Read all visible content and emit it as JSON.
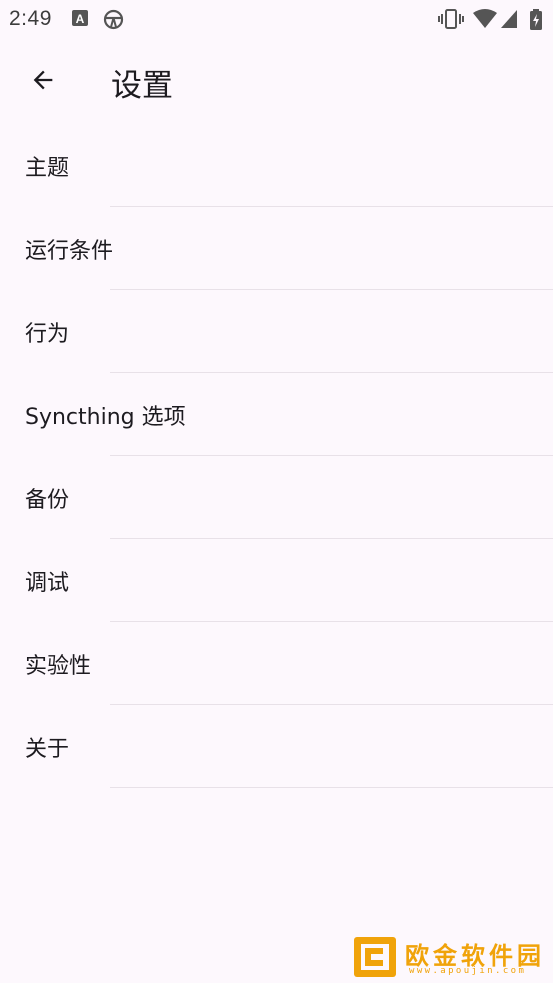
{
  "status_bar": {
    "time": "2:49",
    "icons": [
      "a-notification-icon",
      "steering-wheel-icon",
      "vibrate-icon",
      "wifi-icon",
      "cell-signal-icon",
      "battery-charging-icon"
    ]
  },
  "app_bar": {
    "back_icon": "arrow-back-icon",
    "title": "设置"
  },
  "settings": {
    "items": [
      {
        "label": "主题"
      },
      {
        "label": "运行条件"
      },
      {
        "label": "行为"
      },
      {
        "label": "Syncthing 选项"
      },
      {
        "label": "备份"
      },
      {
        "label": "调试"
      },
      {
        "label": "实验性"
      },
      {
        "label": "关于"
      }
    ]
  },
  "watermark": {
    "text": "欧金软件园",
    "url": "www.apoujin.com",
    "color": "#f0a30a"
  },
  "colors": {
    "background": "#fdf8fd",
    "text": "#1d1b20",
    "divider": "#e8e1e8"
  }
}
